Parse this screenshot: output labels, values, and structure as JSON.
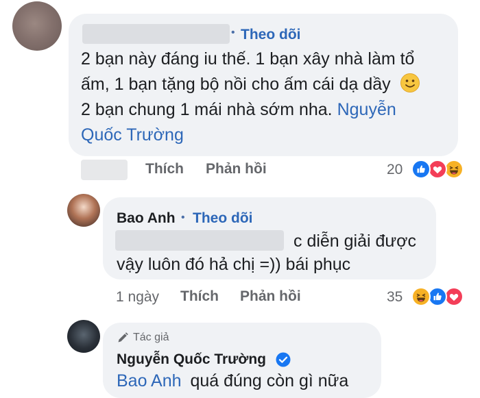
{
  "comment_1": {
    "follow_label": "Theo dõi",
    "text_line_1": "2 bạn này đáng iu thế. 1 bạn xây nhà làm tổ",
    "text_line_2": "ấm, 1 bạn tặng bộ nồi cho ấm cái dạ dầy",
    "text_line_3": "2 bạn chung 1 mái nhà sớm nha.",
    "mention_part_1": "Nguyễn",
    "mention_part_2": "Quốc Trường",
    "emoji_icon": "smile-emoji-icon",
    "like_label": "Thích",
    "reply_label": "Phản hồi",
    "reaction_count": "20",
    "reactions": [
      "like",
      "love",
      "haha"
    ]
  },
  "comment_2": {
    "author": "Bao Anh",
    "follow_label": "Theo dõi",
    "text_line_1_suffix": "c diễn giải được",
    "text_line_2": "vậy luôn đó hả chị =)) bái phục",
    "time": "1 ngày",
    "like_label": "Thích",
    "reply_label": "Phản hồi",
    "reaction_count": "35",
    "reactions": [
      "haha",
      "like",
      "love"
    ]
  },
  "comment_3": {
    "badge_label": "Tác giả",
    "badge_icon": "pen-icon",
    "author": "Nguyễn Quốc Trường",
    "verified_icon": "verified-badge-icon",
    "mention": "Bao Anh",
    "text": "quá đúng còn gì nữa"
  },
  "colors": {
    "bubble": "#f0f2f5",
    "link": "#2d67b8",
    "secondary_text": "#65676b",
    "like": "#1877f2",
    "love": "#f33e58",
    "haha": "#f7b125"
  }
}
